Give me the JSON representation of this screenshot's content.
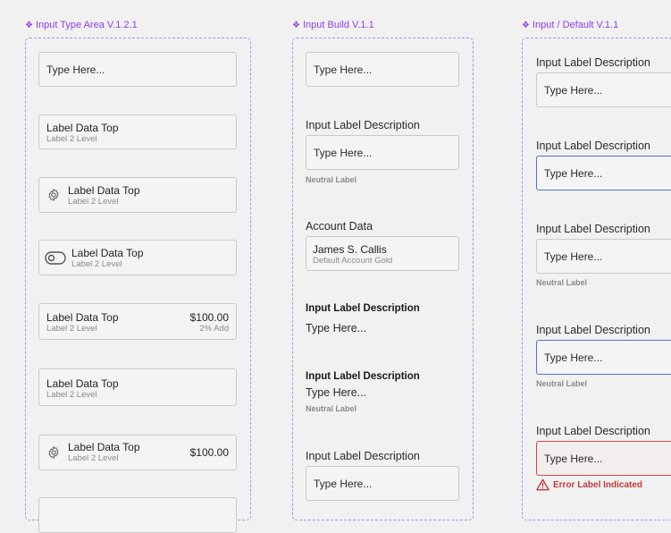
{
  "frames": {
    "left": {
      "title": "Input Type Area V.1.2.1"
    },
    "middle": {
      "title": "Input Build  V.1.1"
    },
    "right": {
      "title": "Input / Default V.1.1"
    }
  },
  "left": {
    "box1": {
      "placeholder": "Type Here..."
    },
    "box2": {
      "main": "Label Data Top",
      "sub": "Label 2 Level"
    },
    "box3": {
      "main": "Label Data Top",
      "sub": "Label 2 Level"
    },
    "box4": {
      "main": "Label Data Top",
      "sub": "Label 2 Level"
    },
    "box5": {
      "main": "Label Data Top",
      "sub": "Label 2 Level",
      "price": "$100.00",
      "price_sub": "2% Add"
    },
    "box6": {
      "main": "Label Data Top",
      "sub": "Label 2 Level"
    },
    "box7": {
      "main": "Label Data Top",
      "sub": "Label 2 Level",
      "price": "$100.00"
    }
  },
  "middle": {
    "input1": {
      "placeholder": "Type Here..."
    },
    "input2": {
      "label": "Input Label Description",
      "placeholder": "Type Here...",
      "helper": "Neutral Label"
    },
    "account": {
      "label": "Account Data",
      "name": "James S. Callis",
      "tier": "Default Account Gold"
    },
    "plain1": {
      "label": "Input Label Description",
      "value": "Type Here..."
    },
    "plain2": {
      "label": "Input Label Description",
      "value": "Type Here...",
      "helper": "Neutral Label"
    },
    "input3": {
      "label": "Input Label Description",
      "placeholder": "Type Here..."
    }
  },
  "right": {
    "field1": {
      "label": "Input Label Description",
      "placeholder": "Type Here..."
    },
    "field2": {
      "label": "Input Label Description",
      "placeholder": "Type Here..."
    },
    "field3": {
      "label": "Input Label Description",
      "placeholder": "Type Here...",
      "helper": "Neutral Label"
    },
    "field4": {
      "label": "Input Label Description",
      "placeholder": "Type Here...",
      "helper": "Neutral Label"
    },
    "field5": {
      "label": "Input Label Description",
      "placeholder": "Type Here...",
      "error": "Error Label Indicated"
    }
  },
  "colors": {
    "accent": "#8e3ee6",
    "focus": "#4f72d4",
    "error": "#d04848"
  },
  "icons": [
    "component-diamond-icon",
    "gear-icon",
    "toggle-icon",
    "warning-triangle-icon"
  ]
}
